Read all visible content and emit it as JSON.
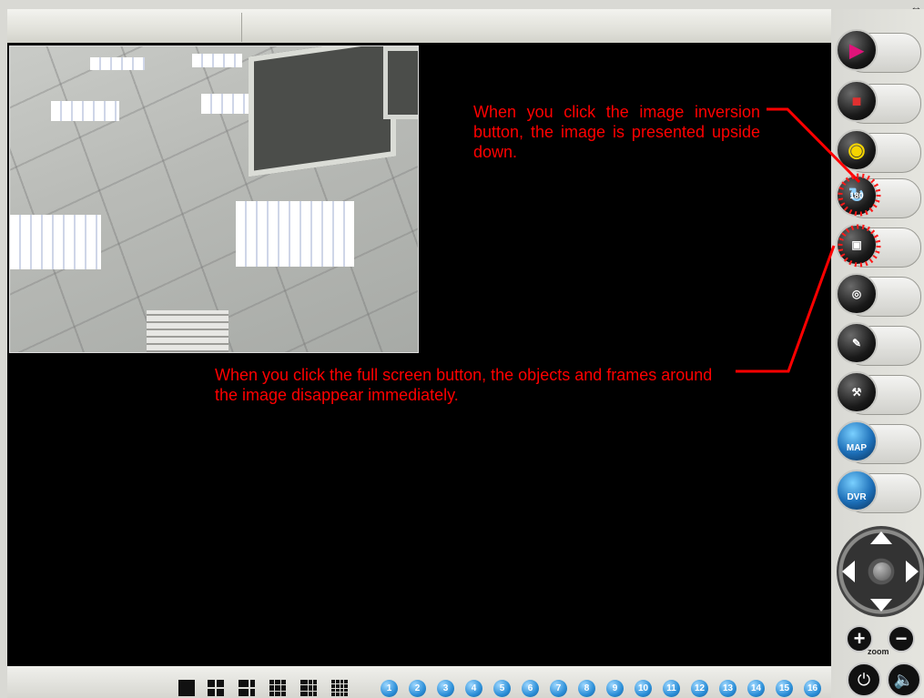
{
  "corner_glyph": "↔",
  "callouts": {
    "inversion": "When you click the image inversion button, the image is presented upside down.",
    "fullscreen": "When you click the full screen button, the objects and frames around the image disappear immediately."
  },
  "sidebar": {
    "buttons": [
      {
        "icon": "play-icon",
        "label": ""
      },
      {
        "icon": "record-icon",
        "label": ""
      },
      {
        "icon": "snapshot-icon",
        "label": ""
      },
      {
        "icon": "rotate-180-icon",
        "label": "180"
      },
      {
        "icon": "fullscreen-icon",
        "label": ""
      },
      {
        "icon": "mouse-icon",
        "label": ""
      },
      {
        "icon": "video-edit-icon",
        "label": ""
      },
      {
        "icon": "tools-icon",
        "label": ""
      },
      {
        "icon": "map-icon",
        "label": "MAP"
      },
      {
        "icon": "dvr-icon",
        "label": "DVR"
      }
    ],
    "zoom_label": "zoom",
    "zoom_in": "+",
    "zoom_out": "−"
  },
  "bottom": {
    "channels": [
      "1",
      "2",
      "3",
      "4",
      "5",
      "6",
      "7",
      "8",
      "9",
      "10",
      "11",
      "12",
      "13",
      "14",
      "15",
      "16"
    ]
  },
  "colors": {
    "annotation": "#ff0000",
    "channel": "#2c8fd8",
    "play": "#e0147a",
    "speaker": "#e01818"
  }
}
